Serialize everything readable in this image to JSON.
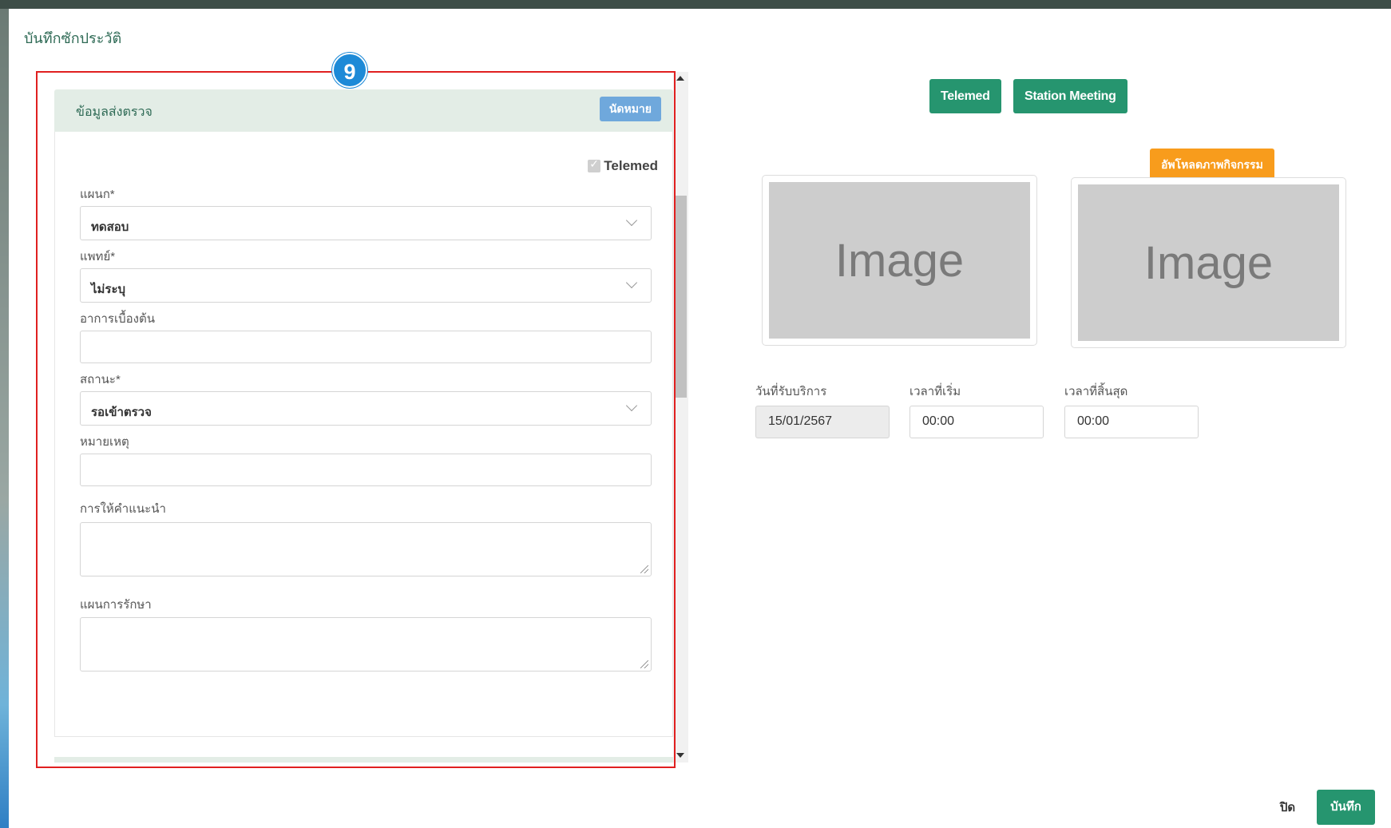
{
  "modal": {
    "title": "บันทึกซักประวัติ"
  },
  "annotation": {
    "step_number": "9"
  },
  "referral_panel": {
    "title": "ข้อมูลส่งตรวจ",
    "appointment_button": "นัดหมาย",
    "telemed_checkbox": {
      "label": "Telemed",
      "checked": true
    },
    "fields": {
      "department": {
        "label": "แผนก*",
        "value": "ทดสอบ"
      },
      "doctor": {
        "label": "แพทย์*",
        "value": "ไม่ระบุ"
      },
      "initial_symptoms": {
        "label": "อาการเบื้องต้น",
        "value": ""
      },
      "status": {
        "label": "สถานะ*",
        "value": "รอเข้าตรวจ"
      },
      "note": {
        "label": "หมายเหตุ",
        "value": ""
      },
      "advice": {
        "label": "การให้คำแนะนำ",
        "value": ""
      },
      "treatment_plan": {
        "label": "แผนการรักษา",
        "value": ""
      }
    }
  },
  "right_panel": {
    "telemed_button": "Telemed",
    "station_meeting_button": "Station Meeting",
    "upload_activity_button": "อัพโหลดภาพกิจกรรม",
    "image_placeholder_1": "Image",
    "image_placeholder_2": "Image",
    "service_date": {
      "label": "วันที่รับบริการ",
      "value": "15/01/2567"
    },
    "start_time": {
      "label": "เวลาที่เริ่ม",
      "value": "00:00"
    },
    "end_time": {
      "label": "เวลาที่สิ้นสุด",
      "value": "00:00"
    }
  },
  "footer": {
    "close_button": "ปิด",
    "save_button": "บันทึก"
  },
  "colors": {
    "accent_teal": "#26956f",
    "header_bg": "#e3ede6",
    "orange": "#f89c1c",
    "info_blue": "#6fa8dc",
    "highlight_red": "#e02020"
  }
}
